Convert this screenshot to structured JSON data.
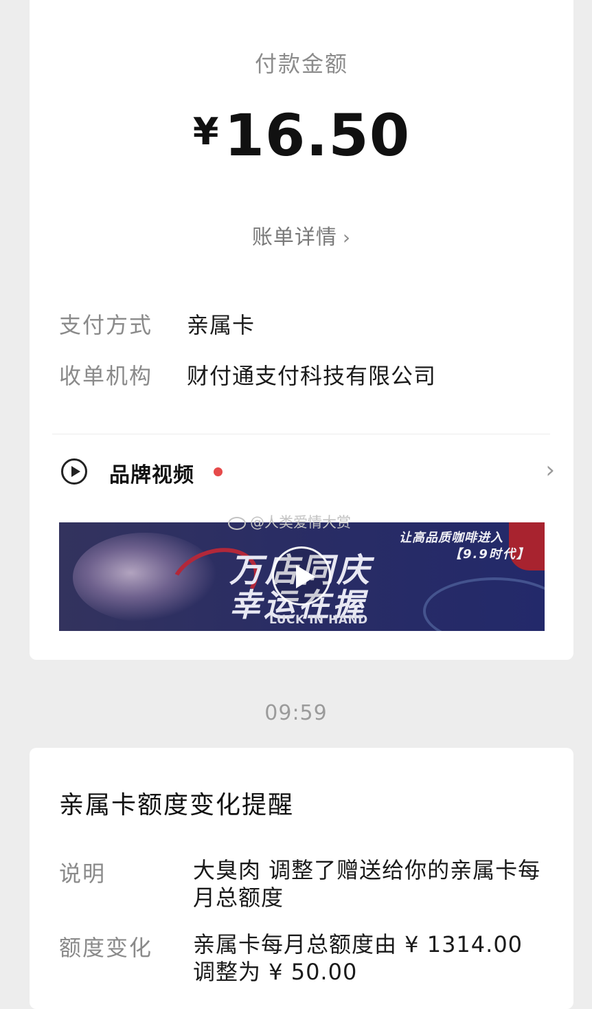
{
  "payment": {
    "amount_label": "付款金额",
    "currency": "¥",
    "amount": "16.50",
    "bill_details": "账单详情",
    "bill_chevron": "›",
    "method_label": "支付方式",
    "method_value": "亲属卡",
    "org_label": "收单机构",
    "org_value": "财付通支付科技有限公司"
  },
  "brand": {
    "label": "品牌视频",
    "chevron": "›",
    "video": {
      "title_line1": "万店同庆",
      "title_line2": "幸运在握",
      "subtitle_line1": "让高品质咖啡进入",
      "subtitle_line2": "【9.9时代】",
      "english": "LUCK IN HAND"
    }
  },
  "watermark": "@人类爱情大赏",
  "timestamp": "09:59",
  "notice": {
    "title": "亲属卡额度变化提醒",
    "desc_label": "说明",
    "desc_value": "大臭肉 调整了赠送给你的亲属卡每月总额度",
    "change_label": "额度变化",
    "change_value": "亲属卡每月总额度由 ¥ 1314.00 调整为 ¥ 50.00"
  },
  "colors": {
    "background": "#ededed",
    "card": "#ffffff",
    "red_dot": "#e64a4a",
    "video_bg": "#2a2d64"
  },
  "icons": {
    "bill_chevron": "chevron-right-icon",
    "brand_play": "play-circle-icon",
    "brand_chevron": "chevron-right-icon",
    "video_play": "play-button-icon"
  }
}
